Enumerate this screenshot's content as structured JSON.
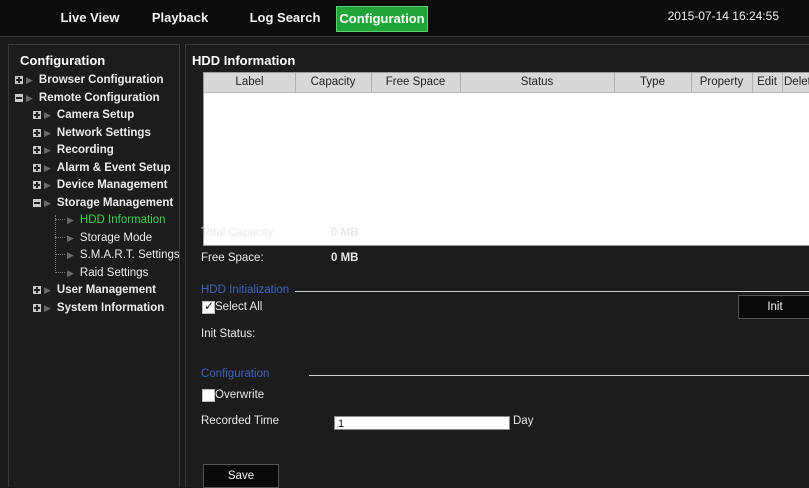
{
  "nav": {
    "tabs": [
      {
        "label": "Live View"
      },
      {
        "label": "Playback"
      },
      {
        "label": "Log Search"
      },
      {
        "label": "Configuration",
        "active": true
      }
    ],
    "datetime": "2015-07-14 16:24:55"
  },
  "sidebar": {
    "title": "Configuration",
    "items": [
      {
        "label": "Browser Configuration"
      },
      {
        "label": "Remote Configuration"
      },
      {
        "label": "Camera Setup"
      },
      {
        "label": "Network Settings"
      },
      {
        "label": "Recording"
      },
      {
        "label": "Alarm & Event Setup"
      },
      {
        "label": "Device Management"
      },
      {
        "label": "Storage Management"
      },
      {
        "label": "HDD Information"
      },
      {
        "label": "Storage Mode"
      },
      {
        "label": "S.M.A.R.T. Settings"
      },
      {
        "label": "Raid Settings"
      },
      {
        "label": "User Management"
      },
      {
        "label": "System Information"
      }
    ]
  },
  "main": {
    "title": "HDD Information",
    "table": {
      "columns": [
        "Label",
        "Capacity",
        "Free Space",
        "Status",
        "Type",
        "Property",
        "Edit",
        "Delete"
      ],
      "rows": []
    },
    "total_capacity_label": "Total Capacity:",
    "total_capacity_value": "0 MB",
    "free_space_label": "Free Space:",
    "free_space_value": "0 MB",
    "hdd_init": {
      "section_title": "HDD Initialization",
      "select_all_label": "Select All",
      "select_all_checked": true,
      "init_button": "Init",
      "init_status_label": "Init Status:"
    },
    "configuration": {
      "section_title": "Configuration",
      "overwrite_label": "Overwrite",
      "overwrite_checked": false,
      "recorded_time_label": "Recorded Time",
      "recorded_time_value": "1",
      "recorded_time_unit": "Day"
    },
    "save_button": "Save"
  },
  "colors": {
    "active_tab": "#1fa53a",
    "current_tree_item": "#39d24f",
    "section_title": "#3f63b8",
    "background": "#1a1a1a"
  }
}
